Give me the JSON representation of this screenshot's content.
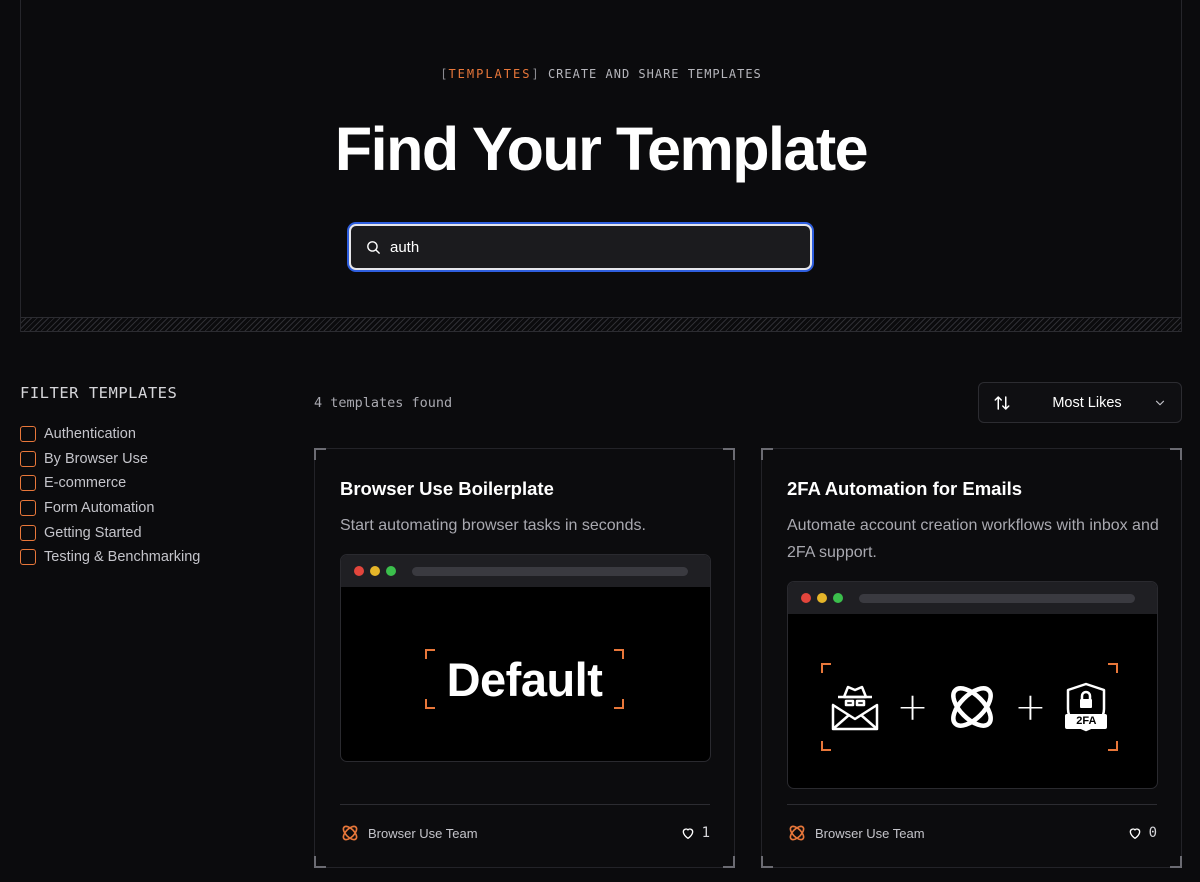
{
  "hero": {
    "eyebrow_open": "[",
    "eyebrow_tag": "TEMPLATES",
    "eyebrow_close": "]",
    "eyebrow_text": "CREATE AND SHARE TEMPLATES",
    "title": "Find Your Template"
  },
  "search": {
    "value": "auth",
    "icon": "search-icon"
  },
  "filters": {
    "title": "FILTER TEMPLATES",
    "items": [
      {
        "label": "Authentication",
        "checked": false
      },
      {
        "label": "By Browser Use",
        "checked": false
      },
      {
        "label": "E-commerce",
        "checked": false
      },
      {
        "label": "Form Automation",
        "checked": false
      },
      {
        "label": "Getting Started",
        "checked": false
      },
      {
        "label": "Testing & Benchmarking",
        "checked": false
      }
    ]
  },
  "results": {
    "count_text": "4 templates found"
  },
  "sort": {
    "selected": "Most Likes",
    "icon": "sort-arrows-icon"
  },
  "cards": [
    {
      "title": "Browser Use Boilerplate",
      "description": "Start automating browser tasks in seconds.",
      "preview_text": "Default",
      "author": "Browser Use Team",
      "likes": "1"
    },
    {
      "title": "2FA Automation for Emails",
      "description": "Automate account creation workflows with inbox and 2FA support.",
      "preview_badge": "2FA",
      "author": "Browser Use Team",
      "likes": "0"
    }
  ],
  "colors": {
    "accent": "#e8773a",
    "background": "#0b0b0d",
    "focus_ring": "#2f5fdf",
    "dot_red": "#e2453c",
    "dot_yellow": "#e5b529",
    "dot_green": "#3bbf4c"
  }
}
